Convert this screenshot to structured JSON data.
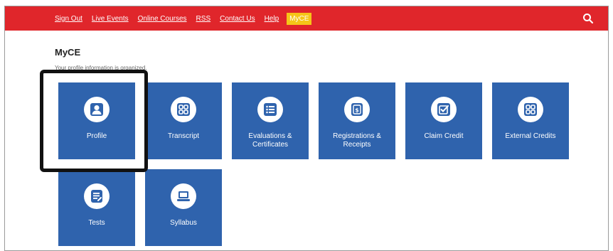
{
  "nav": {
    "items": [
      {
        "label": "Sign Out"
      },
      {
        "label": "Live Events"
      },
      {
        "label": "Online Courses"
      },
      {
        "label": "RSS"
      },
      {
        "label": "Contact Us"
      },
      {
        "label": "Help"
      },
      {
        "label": "MyCE",
        "active": true
      }
    ]
  },
  "page": {
    "title": "MyCE",
    "subtitle": "Your profile information is organized."
  },
  "tiles": [
    {
      "label": "Profile",
      "icon": "user-icon"
    },
    {
      "label": "Transcript",
      "icon": "grid-icon"
    },
    {
      "label": "Evaluations & Certificates",
      "icon": "list-icon"
    },
    {
      "label": "Registrations & Receipts",
      "icon": "receipt-icon"
    },
    {
      "label": "Claim Credit",
      "icon": "checkbox-icon"
    },
    {
      "label": "External Credits",
      "icon": "grid-icon"
    },
    {
      "label": "Tests",
      "icon": "document-icon"
    },
    {
      "label": "Syllabus",
      "icon": "laptop-icon"
    }
  ],
  "colors": {
    "topbar": "#e0262b",
    "active_nav": "#f5c518",
    "tile": "#2f63ad",
    "highlight": "#111111"
  }
}
